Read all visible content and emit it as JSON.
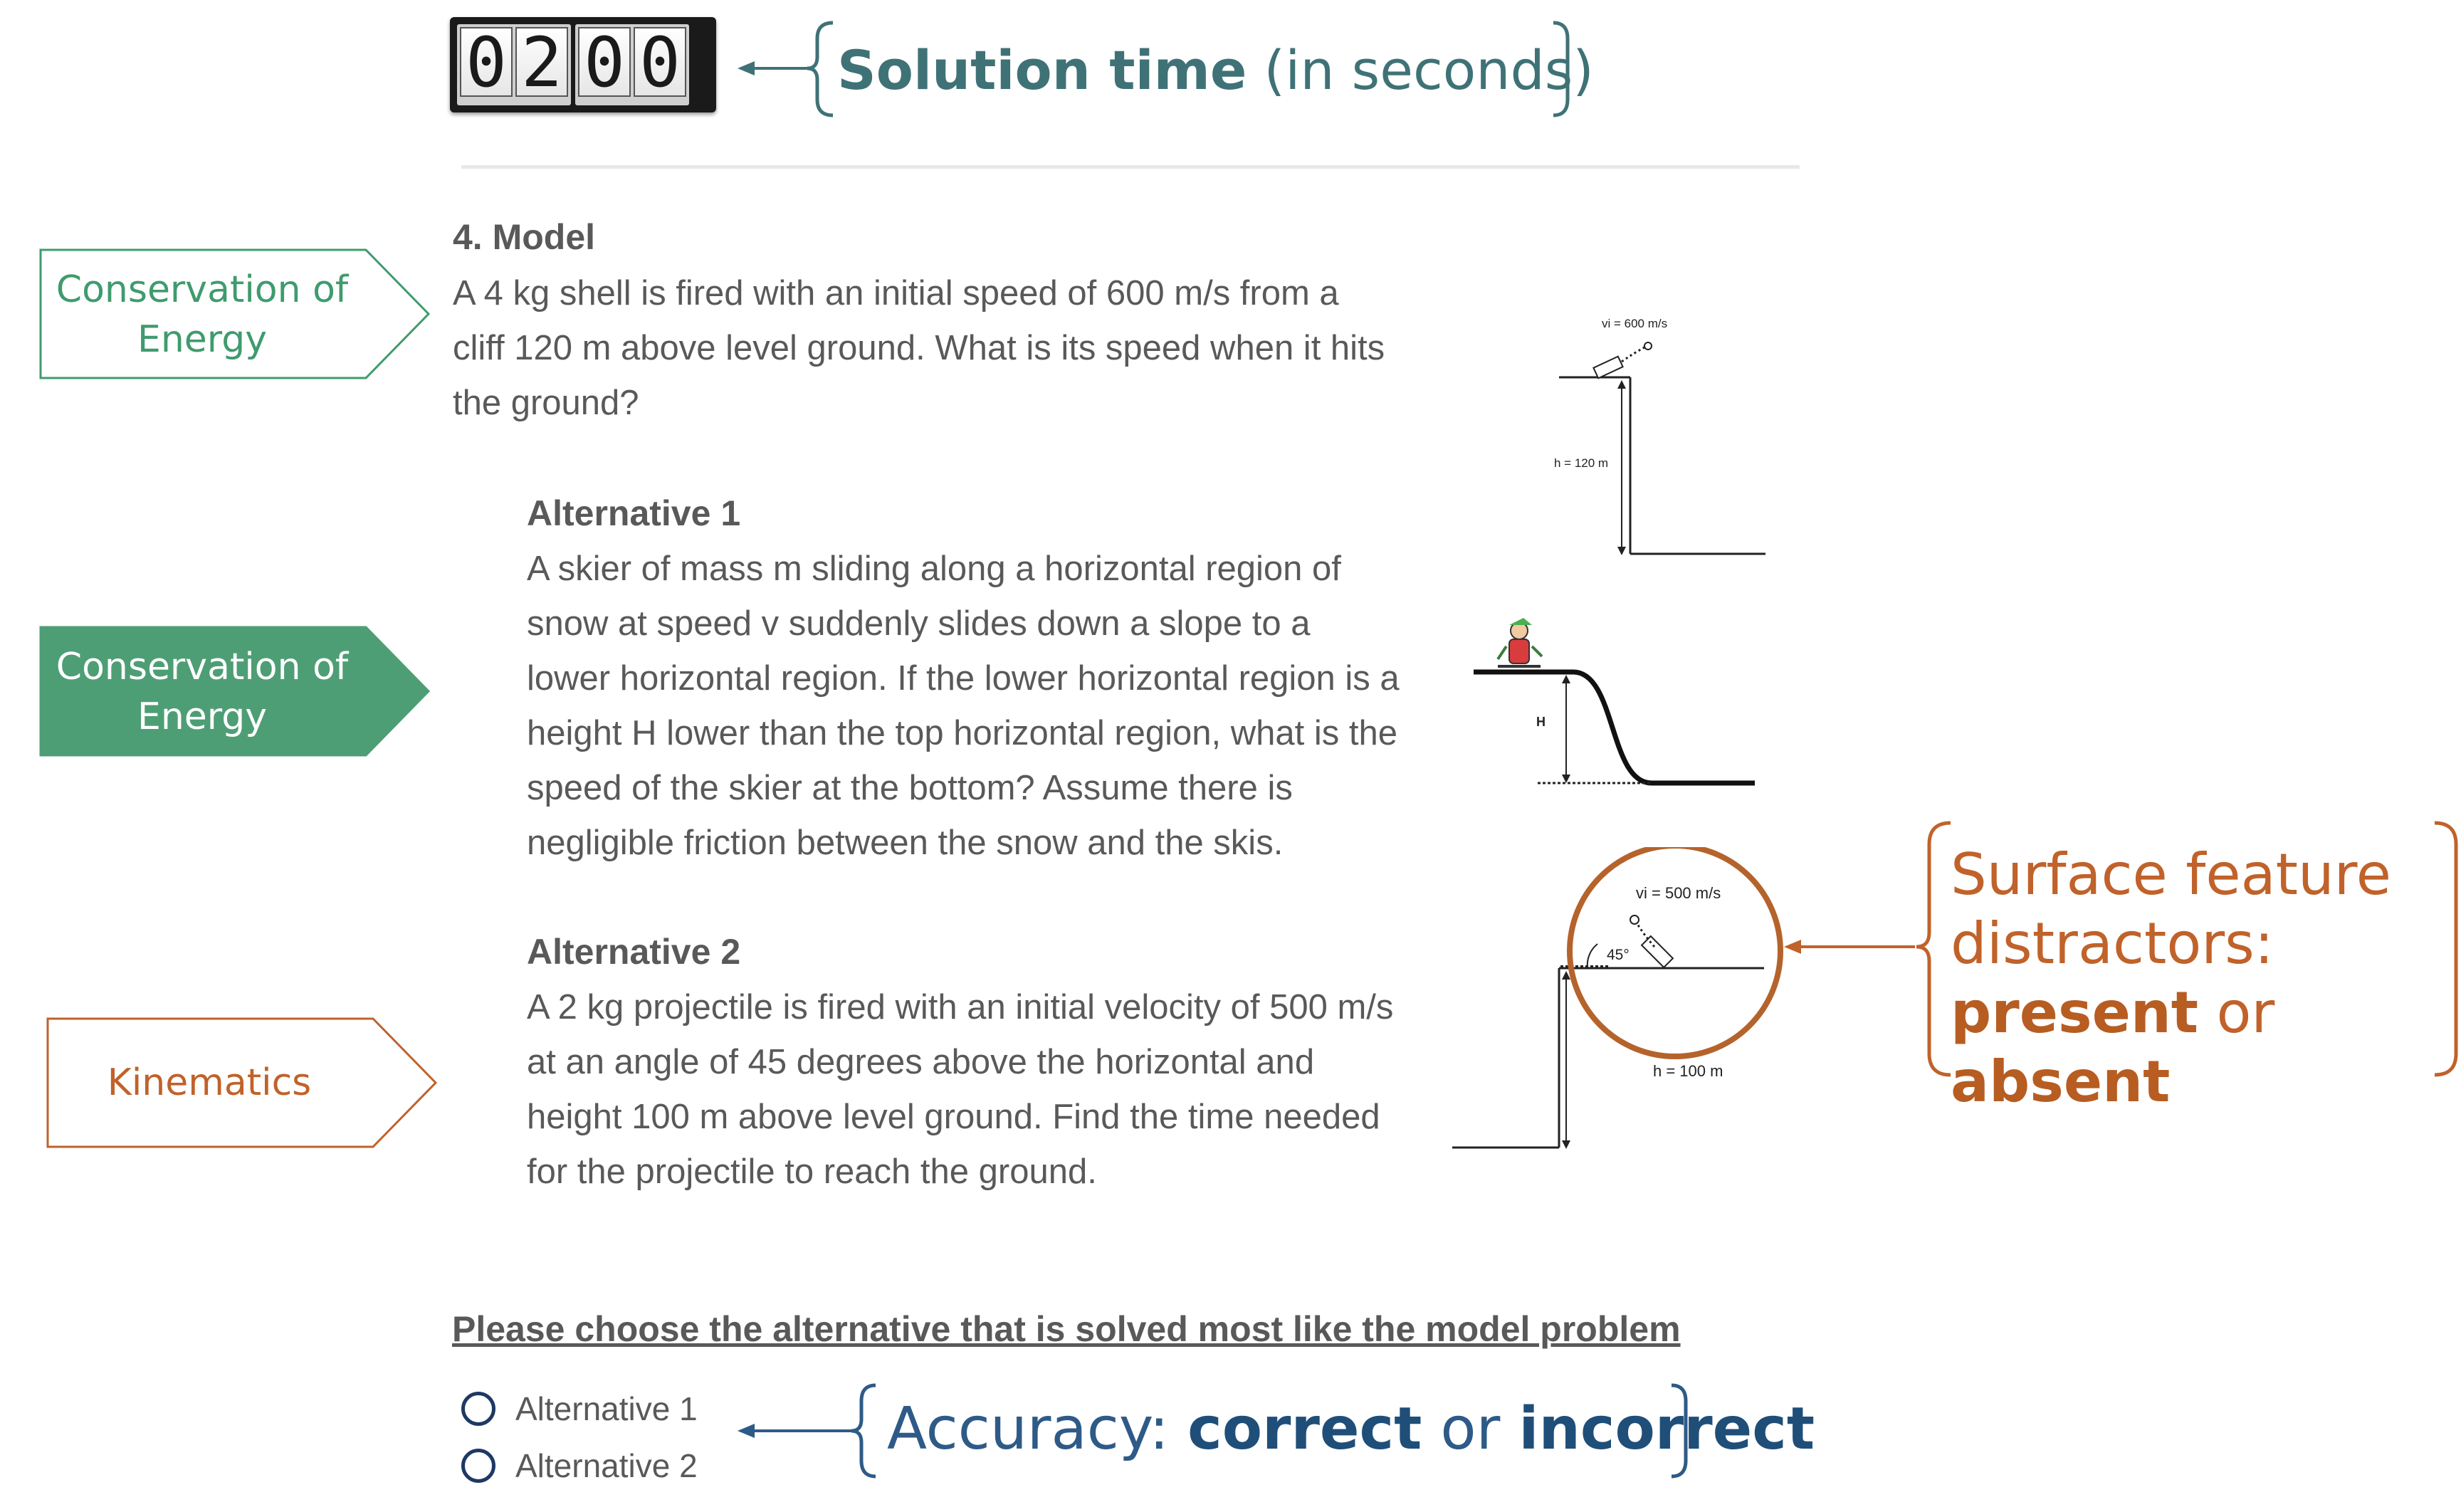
{
  "timer": {
    "digits": [
      "0",
      "2",
      "0",
      "0"
    ]
  },
  "solution_label": {
    "bold": "Solution time",
    "rest": " (in seconds)"
  },
  "model": {
    "title": "4. Model",
    "lines": [
      "A 4 kg shell is fired with an initial speed of 600 m/s from a",
      "cliff 120 m above level ground. What is its speed when it hits",
      "the ground?"
    ],
    "figure": {
      "v_label": "vi = 600 m/s",
      "h_label": "h = 120 m"
    }
  },
  "alternative1": {
    "title": "Alternative 1",
    "lines": [
      "A skier of mass m sliding along a horizontal region of",
      "snow at speed v suddenly slides down a slope to a",
      "lower horizontal region. If the lower horizontal region is a",
      "height H lower than the top horizontal region, what is the",
      "speed of the skier at the bottom? Assume there is",
      "negligible friction between the snow and the skis."
    ],
    "figure": {
      "h_label": "H"
    }
  },
  "alternative2": {
    "title": "Alternative 2",
    "lines": [
      "A 2 kg projectile is fired with an initial velocity of 500 m/s",
      "at an angle of 45 degrees above the horizontal and",
      "height 100 m above level ground. Find the time needed",
      "for the projectile to reach the ground."
    ],
    "figure": {
      "v_label": "vi = 500 m/s",
      "angle_label": "45°",
      "h_label": "h = 100 m"
    }
  },
  "tags": {
    "model": {
      "line1": "Conservation of",
      "line2": "Energy",
      "color": "#3f9b6e"
    },
    "alt1": {
      "line1": "Conservation of",
      "line2": "Energy",
      "fill": "#4e9e75",
      "text_color": "#ffffff"
    },
    "alt2": {
      "label": "Kinematics",
      "color": "#c0622a"
    }
  },
  "question": {
    "prompt": "Please choose the alternative that is solved most like the model problem",
    "options": [
      "Alternative 1",
      "Alternative 2"
    ]
  },
  "accuracy": {
    "prefix": "Accuracy: ",
    "correct": "correct",
    "or": " or ",
    "incorrect": "incorrect"
  },
  "surface": {
    "line1": "Surface feature",
    "line2": "distractors:",
    "present": "present",
    "or": " or ",
    "absent": "absent"
  }
}
